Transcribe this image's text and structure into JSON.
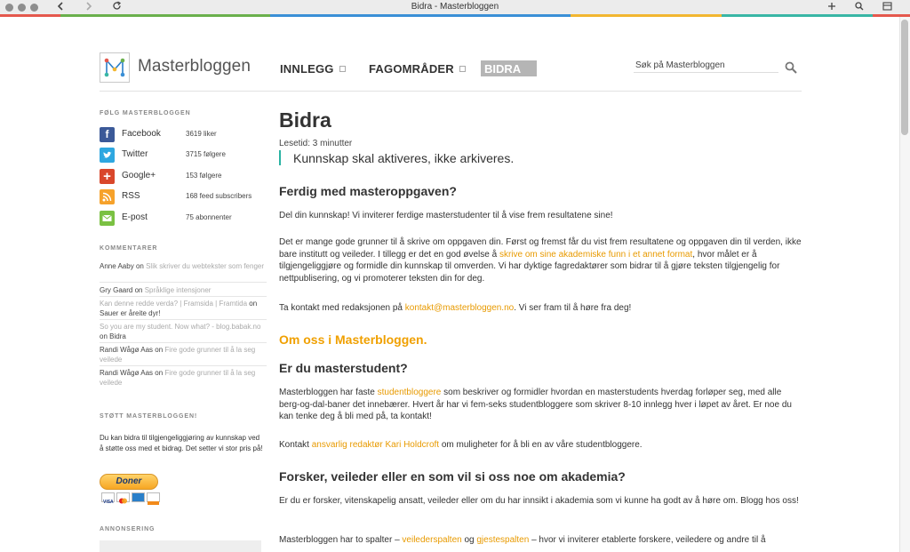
{
  "browser": {
    "title": "Bidra - Masterbloggen",
    "back_icon": "chevron-left-icon",
    "forward_icon": "chevron-right-icon",
    "reload_icon": "reload-icon",
    "new_tab_icon": "plus-icon",
    "zoom_icon": "search-icon",
    "sidebar_icon": "sidebar-icon",
    "accent_colors": [
      "#e4584d",
      "#6ab04c",
      "#3a8fd6",
      "#f2b630",
      "#39b6a5",
      "#e4584d"
    ]
  },
  "header": {
    "logo_text": "Masterbloggen",
    "nav": [
      {
        "label": "INNLEGG"
      },
      {
        "label": "FAGOMRÅDER"
      },
      {
        "label": "BIDRA"
      }
    ],
    "search_placeholder": "Søk på Masterbloggen"
  },
  "sidebar": {
    "follow_heading": "FØLG MASTERBLOGGEN",
    "social": [
      {
        "name": "Facebook",
        "count": "3619 liker",
        "icon": "facebook-icon",
        "color": "#3b5998"
      },
      {
        "name": "Twitter",
        "count": "3715 følgere",
        "icon": "twitter-icon",
        "color": "#2ea7e0"
      },
      {
        "name": "Google+",
        "count": "153 følgere",
        "icon": "google-plus-icon",
        "color": "#d9472b"
      },
      {
        "name": "RSS",
        "count": "168 feed subscribers",
        "icon": "rss-icon",
        "color": "#f6a22b"
      },
      {
        "name": "E-post",
        "count": "75 abonnenter",
        "icon": "email-icon",
        "color": "#7ac142"
      }
    ],
    "comments_heading": "KOMMENTARER",
    "comments": [
      {
        "author": "Anne Aaby",
        "on": "on",
        "post": "Slik skriver du webtekster som fenger"
      },
      {
        "author": "Gry Gaard",
        "on": "on",
        "post": "Språklige intensjoner"
      },
      {
        "author": "Kan denne redde verda? | Framsida | Framtida",
        "on": "on",
        "post": "Sauer er åreite dyr!"
      },
      {
        "author": "So you are my student. Now what? - blog.babak.no",
        "on": "on",
        "post": "Bidra"
      },
      {
        "author": "Randi Wågø Aas",
        "on": "on",
        "post": "Fire gode grunner til å la seg veilede"
      },
      {
        "author": "Randi Wågø Aas",
        "on": "on",
        "post": "Fire gode grunner til å la seg veilede"
      }
    ],
    "support_heading": "STØTT MASTERBLOGGEN!",
    "support_text": "Du kan bidra til tilgjengeliggjøring av kunnskap ved å støtte oss med et bidrag. Det setter vi stor pris på!",
    "donate_label": "Doner",
    "ad_heading": "ANNONSERING"
  },
  "article": {
    "title": "Bidra",
    "read_time": "Lesetid: 3 minutter",
    "lead": "Kunnskap skal aktiveres, ikke arkiveres.",
    "h_done": "Ferdig med masteroppgaven?",
    "p1": "Del din kunnskap! Vi inviterer ferdige masterstudenter til å vise frem resultatene sine!",
    "p2_a": "Det er mange gode grunner til å skrive om oppgaven din. Først og fremst får du vist frem resultatene og oppgaven din til verden, ikke bare institutt og veileder. I tillegg er det en god øvelse å ",
    "p2_link": "skrive om sine akademiske funn i et annet format",
    "p2_b": ", hvor målet er å tilgjengeliggjøre og formidle din kunnskap til omverden. Vi har dyktige fagredaktører som bidrar til å gjøre teksten tilgjengelig for nettpublisering, og vi promoterer teksten din for deg.",
    "p3_a": "Ta kontakt med redaksjonen på ",
    "p3_link": "kontakt@masterbloggen.no",
    "p3_b": ". Vi ser fram til å høre fra deg!",
    "h_about": "Om oss i Masterbloggen.",
    "h_student": "Er du masterstudent?",
    "p4_a": "Masterbloggen har faste ",
    "p4_link": "studentbloggere",
    "p4_b": " som beskriver og formidler hvordan en masterstudents hverdag forløper seg, med alle berg-og-dal-baner det innebærer. Hvert år har vi fem-seks studentbloggere som skriver 8-10 innlegg hver i løpet av året. Er noe du kan tenke deg å bli med på, ta kontakt!",
    "p5_a": "Kontakt ",
    "p5_link": "ansvarlig redaktør Kari Holdcroft",
    "p5_b": " om muligheter for å bli en av våre studentbloggere.",
    "h_research": "Forsker, veileder eller en som vil si oss noe om akademia?",
    "p6": "Er du er forsker, vitenskapelig ansatt, veileder eller om du har innsikt i akademia som vi kunne ha godt av å høre om. Blogg hos oss!",
    "p7_a": "Masterbloggen har to spalter – ",
    "p7_link1": "veilederspalten",
    "p7_mid": " og ",
    "p7_link2": "gjestespalten",
    "p7_b": " – hvor vi inviterer etablerte forskere, veiledere og andre til å"
  }
}
